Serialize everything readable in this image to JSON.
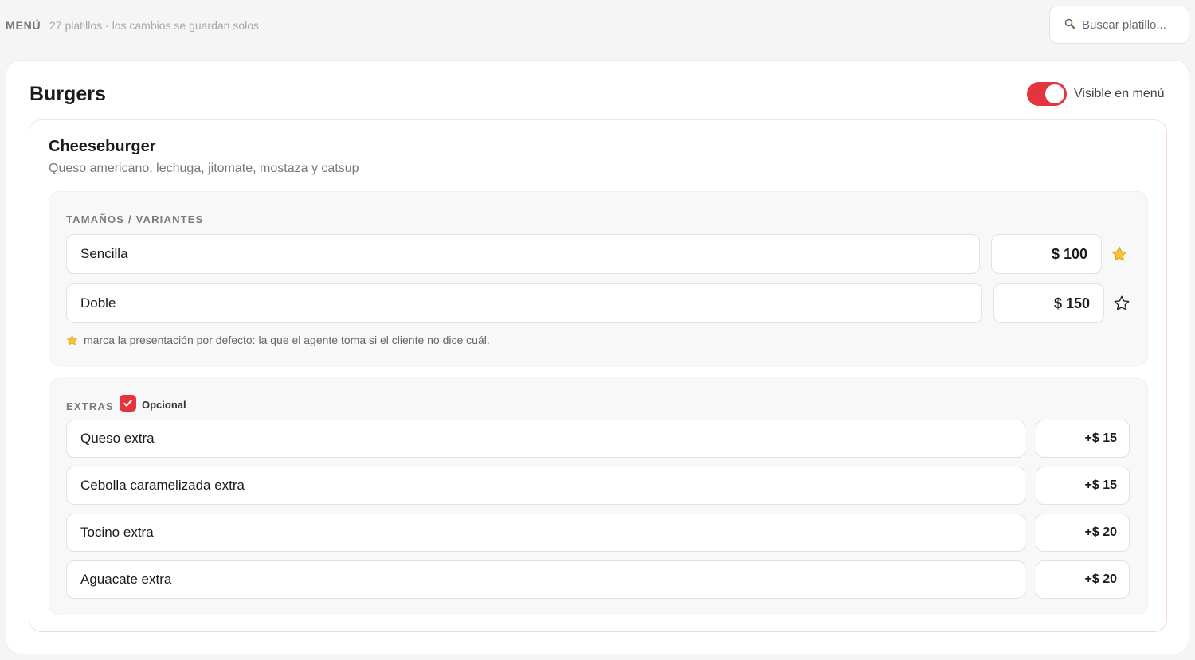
{
  "header": {
    "menu_label": "MENÚ",
    "subtitle": "27 platillos · los cambios se guardan solos",
    "search": {
      "placeholder": "Buscar platillo...",
      "value": ""
    },
    "search_icon": "search-icon"
  },
  "category": {
    "title": "Burgers",
    "visible_label": "Visible en menú",
    "visible_on": true,
    "accent_color": "#e3343f"
  },
  "dish": {
    "name": "Cheeseburger",
    "description": "Queso americano, lechuga, jitomate, mostaza y catsup",
    "variants": {
      "heading": "TAMAÑOS / VARIANTES",
      "items": [
        {
          "name": "Sencilla",
          "price": "$ 100",
          "default": true
        },
        {
          "name": "Doble",
          "price": "$ 150",
          "default": false
        }
      ],
      "hint": "marca la presentación por defecto: la que el agente toma si el cliente no dice cuál."
    },
    "extras": {
      "heading": "EXTRAS",
      "optional_label": "Opcional",
      "optional_checked": true,
      "items": [
        {
          "name": "Queso extra",
          "price": "+$ 15"
        },
        {
          "name": "Cebolla caramelizada extra",
          "price": "+$ 15"
        },
        {
          "name": "Tocino extra",
          "price": "+$ 20"
        },
        {
          "name": "Aguacate extra",
          "price": "+$ 20"
        }
      ]
    }
  }
}
